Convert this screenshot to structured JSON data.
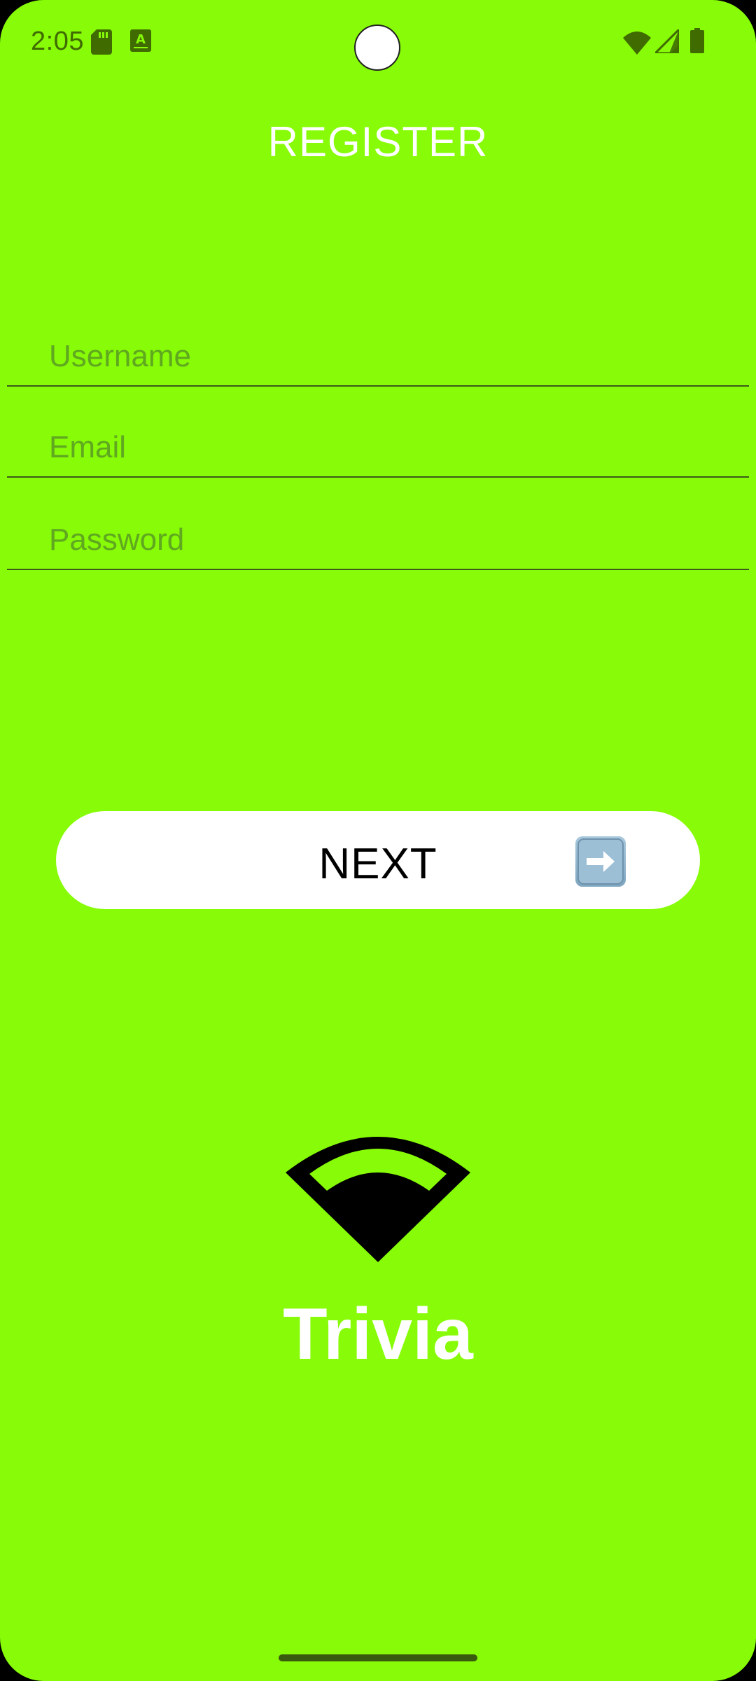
{
  "status_bar": {
    "time": "2:05",
    "icons": [
      "sd-card-icon",
      "a-keyboard-icon",
      "wifi-icon",
      "cellular-signal-icon",
      "battery-icon"
    ]
  },
  "page": {
    "title": "REGISTER"
  },
  "form": {
    "username_placeholder": "Username",
    "username_value": "",
    "email_placeholder": "Email",
    "email_value": "",
    "password_placeholder": "Password",
    "password_value": ""
  },
  "next_button": {
    "label": "NEXT",
    "icon": "right-arrow-icon"
  },
  "brand": {
    "name": "Trivia",
    "logo_icon": "wifi-wedge-icon"
  },
  "colors": {
    "background": "#87FB07",
    "button": "#FFFFFF",
    "text_light": "#FFFFFF"
  }
}
